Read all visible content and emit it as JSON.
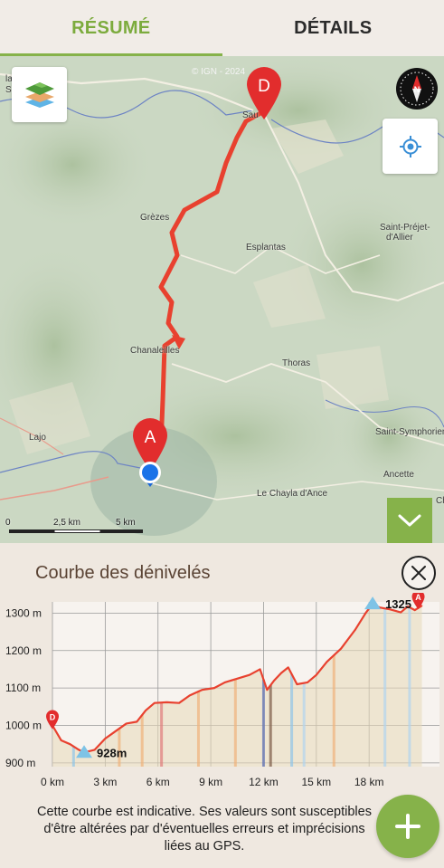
{
  "tabs": [
    {
      "label": "RÉSUMÉ",
      "active": true
    },
    {
      "label": "DÉTAILS",
      "active": false
    }
  ],
  "map": {
    "attribution": "© IGN - 2024",
    "places": {
      "greze": "Grèzes",
      "esplantas": "Esplantas",
      "saint_prejet": "Saint-Préjet-",
      "saint_prejet_2": "d'Allier",
      "thoras": "Thoras",
      "chanaleilles": "Chanaleilles",
      "lajo": "Lajo",
      "saint_symphorien": "Saint-Symphorien",
      "ancette": "Ancette",
      "le_chayla": "Le Chayla d'Ance",
      "saugues": "Sau",
      "la_besseyre": "la Bes",
      "la_besseyre2": "Sair",
      "chayla_right": "Cha"
    },
    "markers": {
      "start": "A",
      "end": "D"
    },
    "scale": {
      "left": "0",
      "mid": "2,5 km",
      "right": "5 km"
    },
    "icons": [
      "layers-icon",
      "compass-icon",
      "locate-icon",
      "chevron-down-icon"
    ]
  },
  "elevation": {
    "title": "Courbe des dénivelés",
    "min_label": "928m",
    "max_label": "1325",
    "disclaimer": "Cette courbe est indicative. Ses valeurs sont susceptibles d'être altérées par d'éventuelles erreurs et imprécisions liées au GPS.",
    "colors": {
      "line": "#e8412f",
      "marker": "#e22d2d",
      "peak": "#7ec3e6",
      "fab": "#86b24a"
    }
  },
  "chart_data": {
    "type": "area",
    "title": "Courbe des dénivelés",
    "xlabel": "",
    "ylabel": "",
    "y_ticks": [
      "1300 m",
      "1200 m",
      "1100 m",
      "1000 m",
      "900 m"
    ],
    "x_ticks": [
      "0 km",
      "3 km",
      "6 km",
      "9 km",
      "12 km",
      "15 km",
      "18 km"
    ],
    "xlim": [
      0,
      22
    ],
    "ylim": [
      890,
      1330
    ],
    "x": [
      0,
      0.5,
      1,
      1.5,
      1.8,
      2.4,
      3,
      3.6,
      4.2,
      4.8,
      5.3,
      5.8,
      6.5,
      7.2,
      7.8,
      8.5,
      9.2,
      9.8,
      10.5,
      11.2,
      11.8,
      12.2,
      12.6,
      13,
      13.4,
      13.9,
      14.5,
      15,
      15.6,
      16.4,
      17.2,
      17.8,
      18.2,
      18.6,
      19.2,
      19.8,
      20.2,
      20.6,
      21
    ],
    "values": [
      1000,
      960,
      950,
      935,
      928,
      935,
      965,
      985,
      1005,
      1010,
      1040,
      1060,
      1062,
      1060,
      1080,
      1095,
      1100,
      1115,
      1125,
      1135,
      1150,
      1095,
      1120,
      1140,
      1155,
      1110,
      1115,
      1135,
      1170,
      1205,
      1255,
      1300,
      1325,
      1315,
      1310,
      1302,
      1318,
      1308,
      1320
    ],
    "annotations": [
      {
        "text": "928m",
        "x": 1.8,
        "y": 928
      },
      {
        "text": "1325",
        "x": 18.2,
        "y": 1325
      }
    ]
  }
}
